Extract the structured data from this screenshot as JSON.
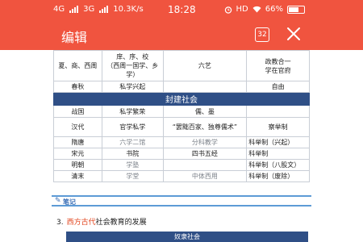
{
  "status_bar": {
    "net1": "4G",
    "net2": "3G",
    "speed": "10.3K/s",
    "time": "18:28",
    "hd": "HD",
    "battery": "66%",
    "battery_level": 0.66
  },
  "title_bar": {
    "title": "编辑",
    "count_badge": "32",
    "close_icon": "close-icon"
  },
  "table": {
    "rows": [
      {
        "c1": "夏、商、西周",
        "c2": "庠、序、校\n（西周一国学、乡学）",
        "c3": "六艺",
        "c4": "政教合一\n学在官府"
      },
      {
        "c1": "春秋",
        "c2": "私学兴起",
        "c3": "",
        "c4": "自由"
      },
      {
        "section": "封建社会"
      },
      {
        "c1": "战国",
        "c2": "私学繁荣",
        "c3": "儒、墨",
        "c4": ""
      },
      {
        "c1": "汉代",
        "c2": "官学私学",
        "c3": "“罢黜百家、独尊儒术”",
        "c4": "察举制"
      },
      {
        "c1": "隋唐",
        "c2": "六学二馆",
        "c3": "分科教学",
        "c4": "科举制（兴起）"
      },
      {
        "c1": "宋元",
        "c2": "书院",
        "c3": "四书五经",
        "c4": "科举制"
      },
      {
        "c1": "明朝",
        "c2": "学塾",
        "c3": "",
        "c4": "科举制（八股文）"
      },
      {
        "c1": "清末",
        "c2": "学堂",
        "c3": "中体西用",
        "c4": "科举制（废除）"
      }
    ]
  },
  "notes": {
    "label": "笔记"
  },
  "item3": {
    "num": "3.",
    "highlight": "西方古代",
    "rest": "社会教育的发展"
  },
  "bottom_header": "奴隶社会",
  "colors": {
    "brand": "#f0543f",
    "table_header": "#2f4f86",
    "notes_accent": "#5d9bd6",
    "highlight": "#e2431c"
  }
}
